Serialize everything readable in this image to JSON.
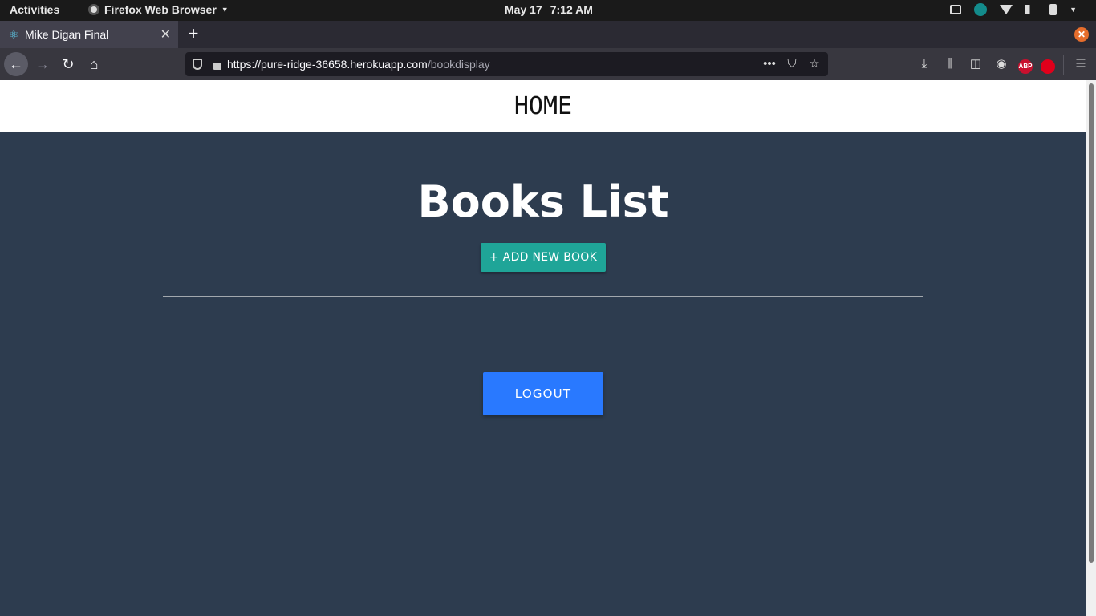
{
  "system_bar": {
    "activities_label": "Activities",
    "app_name": "Firefox Web Browser",
    "date": "May 17",
    "time": "7:12 AM"
  },
  "browser": {
    "tab_title": "Mike Digan Final",
    "url_host": "https://pure-ridge-36658.herokuapp.com",
    "url_path": "/bookdisplay",
    "abp_label": "ABP"
  },
  "page": {
    "home_link": "HOME",
    "title": "Books List",
    "add_button": "+ ADD NEW BOOK",
    "logout_button": "LOGOUT"
  },
  "colors": {
    "page_background": "#2d3c4f",
    "add_button": "#1fa598",
    "logout_button": "#2979ff"
  }
}
